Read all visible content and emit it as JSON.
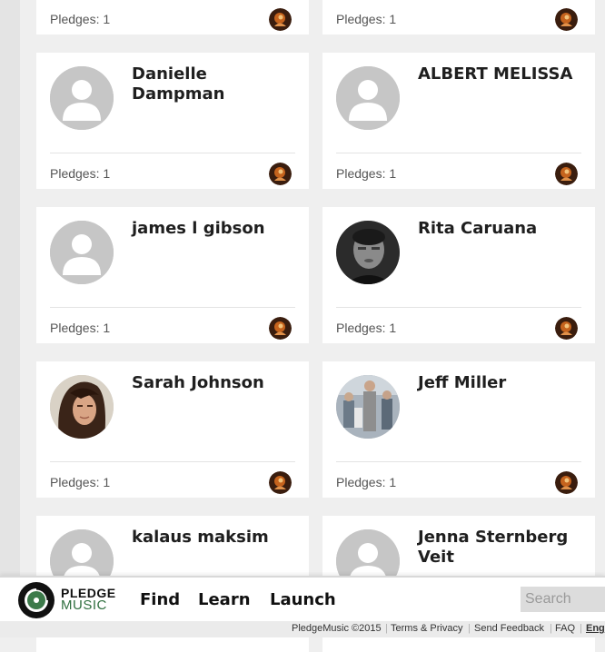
{
  "cards": [
    {
      "name": "",
      "pledges": "Pledges: 1",
      "avatar": "none",
      "partial": true
    },
    {
      "name": "",
      "pledges": "Pledges: 1",
      "avatar": "none",
      "partial": true
    },
    {
      "name": "Danielle Dampman",
      "pledges": "Pledges: 1",
      "avatar": "default-user-icon"
    },
    {
      "name": "ALBERT MELISSA",
      "pledges": "Pledges: 1",
      "avatar": "default-user-icon"
    },
    {
      "name": "james l gibson",
      "pledges": "Pledges: 1",
      "avatar": "default-user-icon"
    },
    {
      "name": "Rita Caruana",
      "pledges": "Pledges: 1",
      "avatar": "photo"
    },
    {
      "name": "Sarah Johnson",
      "pledges": "Pledges: 1",
      "avatar": "photo"
    },
    {
      "name": "Jeff Miller",
      "pledges": "Pledges: 1",
      "avatar": "photo"
    },
    {
      "name": "kalaus maksim",
      "pledges": "",
      "avatar": "default-user-icon"
    },
    {
      "name": "Jenna Sternberg Veit",
      "pledges": "",
      "avatar": "default-user-icon"
    }
  ],
  "nav": {
    "logo_line1": "PLEDGE",
    "logo_line2": "MUSIC",
    "find": "Find",
    "learn": "Learn",
    "launch": "Launch",
    "search_placeholder": "Search"
  },
  "footer": {
    "copyright": "PledgeMusic ©2015",
    "terms": "Terms & Privacy",
    "feedback": "Send Feedback",
    "faq": "FAQ",
    "language": "Eng"
  }
}
